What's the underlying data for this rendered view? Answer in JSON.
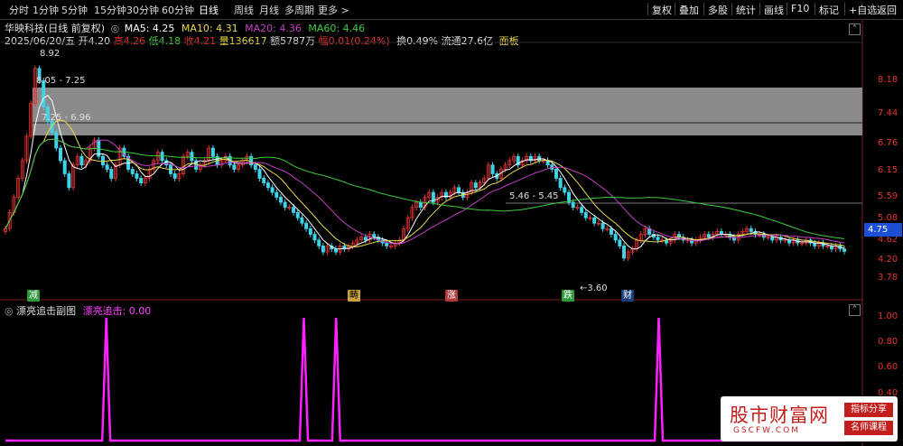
{
  "toolbar": {
    "timeframes": [
      "分时",
      "1分钟",
      "5分钟",
      "15分钟",
      "30分钟",
      "60分钟",
      "日线",
      "周线",
      "月线",
      "多周期",
      "更多 >"
    ],
    "active": "日线",
    "right_buttons": [
      "复权",
      "叠加",
      "多股",
      "统计",
      "画线",
      "F10",
      "标记",
      "+自选",
      "返回"
    ]
  },
  "stock": {
    "name": "华映科技(日线 前复权)",
    "ma5": "MA5: 4.25",
    "ma10": "MA10: 4.31",
    "ma20": "MA20: 4.36",
    "ma60": "MA60: 4.46",
    "date": "2025/06/20/五",
    "open": "开4.20",
    "high": "高4.26",
    "low": "低4.18",
    "close": "收4.21",
    "volume": "量136617",
    "amount": "额5787万",
    "change": "幅0.01(0.24%)",
    "turnover": "换0.49%",
    "float_cap": "流通27.6亿",
    "panel": "面板"
  },
  "main_axis": [
    "8.18",
    "7.44",
    "6.76",
    "6.15",
    "5.59",
    "5.08",
    "4.62",
    "4.20",
    "3.78"
  ],
  "current_price": "4.75",
  "annotations": {
    "high_label": "8.92",
    "box1": "8.05 - 7.25",
    "box2": "7.25 - 6.96",
    "box3": "5.46 - 5.45",
    "low_label": "3.60",
    "low_arrow": "←"
  },
  "signals": [
    {
      "text": "减",
      "color": "#2e9a3a"
    },
    {
      "text": "畴",
      "color": "#c8a23c"
    },
    {
      "text": "涨",
      "color": "#c94040"
    },
    {
      "text": "跌",
      "color": "#2e9a3a"
    },
    {
      "text": "财",
      "color": "#3a8fd8"
    }
  ],
  "sub_panel": {
    "title": "漂亮追击副图",
    "indicator": "漂亮追击: 0.00",
    "axis": [
      "1.00",
      "0.80",
      "0.60",
      "0.40",
      "0.20"
    ]
  },
  "colors": {
    "up": "#e03131",
    "down": "#3fd2e8",
    "ma5": "#ffffff",
    "ma10": "#e8d84a",
    "ma20": "#c43ec4",
    "ma60": "#3fcc3f",
    "indicator": "#ff20ff",
    "zone": "#8a8a8a"
  },
  "indicator_values": [
    0,
    0,
    0,
    0,
    0,
    0,
    0,
    0,
    0,
    0,
    0,
    0,
    0,
    0,
    0,
    0,
    0,
    0,
    0,
    0,
    0,
    0,
    0,
    0,
    0,
    1,
    0,
    0,
    0,
    0,
    0,
    0,
    0,
    0,
    0,
    0,
    0,
    0,
    0,
    0,
    0,
    0,
    0,
    0,
    0,
    0,
    0,
    0,
    0,
    0,
    0,
    0,
    0,
    0,
    0,
    0,
    0,
    0,
    0,
    0,
    0,
    0,
    0,
    0,
    0,
    0,
    0,
    0,
    0,
    0,
    0,
    0,
    0,
    0,
    1,
    0,
    0,
    0,
    0,
    0,
    0,
    0,
    1,
    0,
    0,
    0,
    0,
    0,
    0,
    0,
    0,
    0,
    0,
    0,
    0,
    0,
    0,
    0,
    0,
    0,
    0,
    0,
    0,
    0,
    0,
    0,
    0,
    0,
    0,
    0,
    0,
    0,
    0,
    0,
    0,
    0,
    0,
    0,
    0,
    0,
    0,
    0,
    0,
    0,
    0,
    0,
    0,
    0,
    0,
    0,
    0,
    0,
    0,
    0,
    0,
    0,
    0,
    0,
    0,
    0,
    0,
    0,
    0,
    0,
    0,
    0,
    0,
    0,
    0,
    0,
    0,
    0,
    0,
    0,
    0,
    0,
    0,
    0,
    0,
    0,
    0,
    0,
    1,
    0,
    0,
    0,
    0,
    0,
    0,
    0,
    0,
    0,
    0,
    0,
    0,
    0,
    0,
    0,
    0,
    0,
    0,
    0,
    0,
    0,
    0,
    0,
    0,
    0,
    0,
    0,
    0,
    0,
    0,
    0,
    0,
    0,
    0,
    0,
    0,
    0,
    0,
    0,
    0,
    0,
    0,
    0,
    0,
    0,
    0
  ],
  "watermark": {
    "title": "股市财富网",
    "url": "GSCFW.COM",
    "badge1": "指标分享",
    "badge2": "名师课程"
  },
  "chart_data": {
    "type": "candlestick",
    "closes": [
      4.6,
      4.9,
      5.2,
      5.6,
      6.0,
      6.6,
      7.5,
      8.6,
      8.2,
      7.4,
      7.0,
      6.7,
      6.3,
      6.0,
      5.7,
      5.4,
      5.9,
      6.1,
      5.9,
      6.0,
      6.3,
      6.5,
      6.1,
      5.9,
      5.8,
      5.6,
      5.9,
      6.3,
      6.1,
      5.8,
      5.7,
      5.6,
      5.5,
      5.6,
      5.8,
      6.0,
      6.2,
      6.0,
      5.9,
      5.7,
      5.6,
      5.7,
      6.1,
      6.2,
      6.0,
      5.8,
      5.9,
      6.0,
      6.3,
      6.1,
      5.9,
      6.0,
      6.1,
      5.9,
      5.8,
      5.9,
      6.0,
      6.1,
      5.9,
      5.8,
      5.6,
      5.5,
      5.4,
      5.3,
      5.2,
      5.1,
      5.0,
      5.0,
      4.9,
      4.8,
      4.7,
      4.6,
      4.5,
      4.4,
      4.3,
      4.2,
      4.3,
      4.25,
      4.2,
      4.3,
      4.25,
      4.3,
      4.35,
      4.4,
      4.45,
      4.4,
      4.5,
      4.45,
      4.4,
      4.35,
      4.3,
      4.3,
      4.35,
      4.4,
      4.6,
      4.8,
      5.0,
      5.1,
      5.0,
      5.2,
      5.3,
      5.1,
      5.2,
      5.3,
      5.2,
      5.3,
      5.4,
      5.3,
      5.2,
      5.3,
      5.5,
      5.4,
      5.5,
      5.6,
      5.9,
      5.7,
      5.6,
      5.8,
      5.9,
      6.0,
      6.1,
      5.9,
      6.0,
      6.1,
      6.0,
      6.1,
      6.0,
      6.0,
      5.9,
      5.8,
      5.6,
      5.4,
      5.3,
      5.1,
      5.0,
      5.0,
      4.9,
      4.8,
      4.8,
      4.7,
      4.7,
      4.6,
      4.6,
      4.5,
      4.4,
      4.3,
      4.1,
      4.2,
      4.25,
      4.4,
      4.5,
      4.6,
      4.5,
      4.45,
      4.4,
      4.4,
      4.35,
      4.4,
      4.5,
      4.45,
      4.4,
      4.4,
      4.35,
      4.4,
      4.45,
      4.5,
      4.45,
      4.5,
      4.55,
      4.5,
      4.5,
      4.45,
      4.4,
      4.5,
      4.55,
      4.6,
      4.55,
      4.5,
      4.5,
      4.45,
      4.45,
      4.4,
      4.45,
      4.4,
      4.4,
      4.35,
      4.4,
      4.35,
      4.35,
      4.4,
      4.35,
      4.3,
      4.35,
      4.3,
      4.3,
      4.25,
      4.3,
      4.25,
      4.21
    ],
    "ylim": [
      3.6,
      9.0
    ]
  }
}
